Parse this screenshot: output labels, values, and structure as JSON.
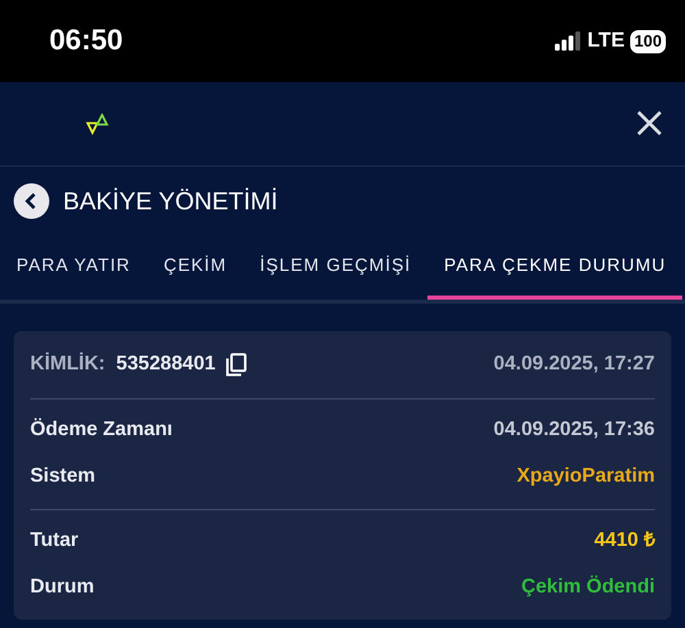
{
  "status_bar": {
    "time": "06:50",
    "network": "LTE",
    "battery": "100"
  },
  "page": {
    "title": "BAKİYE YÖNETİMİ"
  },
  "tabs": [
    {
      "label": "PARA YATIR",
      "selected": false
    },
    {
      "label": "ÇEKİM",
      "selected": false
    },
    {
      "label": "İŞLEM GEÇMİŞİ",
      "selected": false
    },
    {
      "label": "PARA ÇEKME DURUMU",
      "selected": true
    }
  ],
  "transaction": {
    "id_label": "KİMLİK:",
    "id": "535288401",
    "created": "04.09.2025, 17:27",
    "sections": [
      [
        {
          "label": "Ödeme Zamanı",
          "value": "04.09.2025, 17:36",
          "color": "#c4c9d4"
        },
        {
          "label": "Sistem",
          "value": "XpayioParatim",
          "color": "#e6a919"
        }
      ],
      [
        {
          "label": "Tutar",
          "value": "4410 ₺",
          "color": "#f5c518"
        },
        {
          "label": "Durum",
          "value": "Çekim Ödendi",
          "color": "#2fbd3a"
        }
      ]
    ]
  }
}
